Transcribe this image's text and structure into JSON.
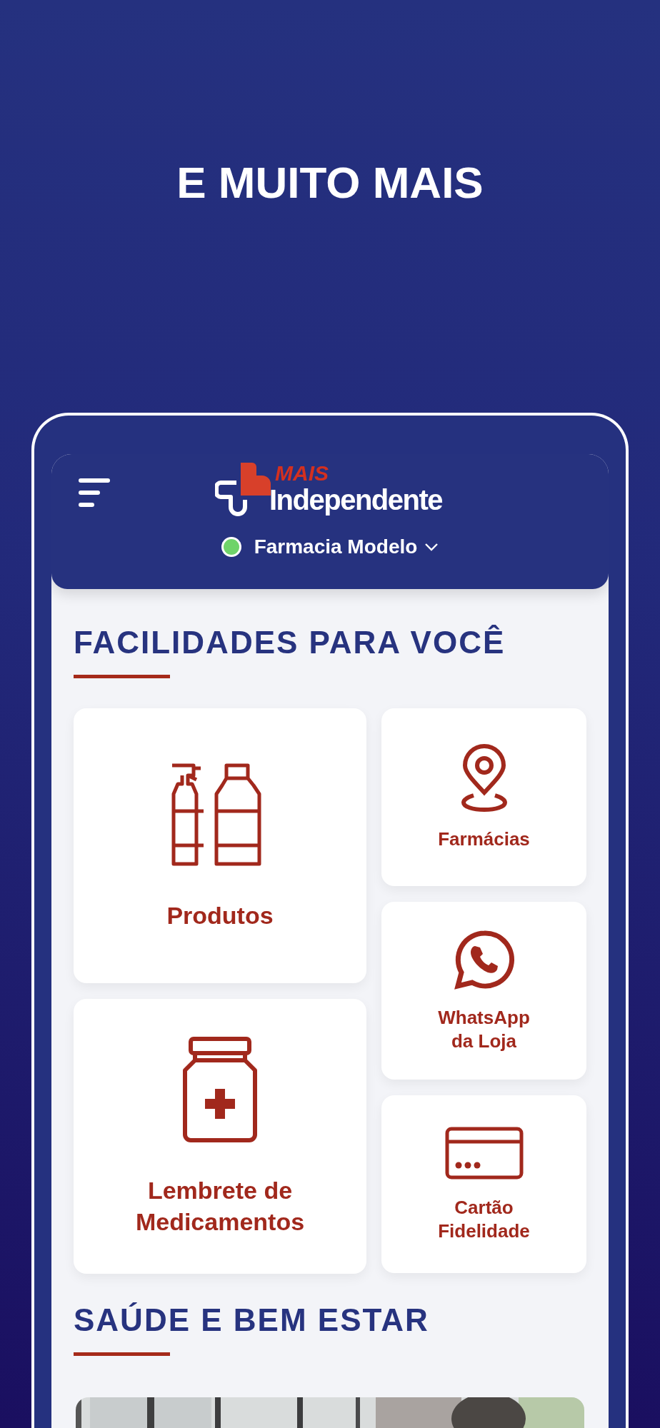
{
  "headline": "E MUITO MAIS",
  "app": {
    "logo_top": "MAIS",
    "logo_main": "Independente",
    "store": {
      "name": "Farmacia Modelo",
      "online": true
    }
  },
  "sections": [
    {
      "title": "FACILIDADES PARA VOCÊ"
    },
    {
      "title": "SAÚDE E BEM ESTAR"
    }
  ],
  "large_cards": [
    {
      "label": "Produtos",
      "kind": "bottles"
    },
    {
      "label": "Lembrete de Medicamentos",
      "kind": "jar"
    }
  ],
  "small_cards": [
    {
      "label": "Farmácias",
      "kind": "pin"
    },
    {
      "label": "WhatsApp da Loja",
      "kind": "whatsapp"
    },
    {
      "label": "Cartão Fidelidade",
      "kind": "card"
    }
  ]
}
